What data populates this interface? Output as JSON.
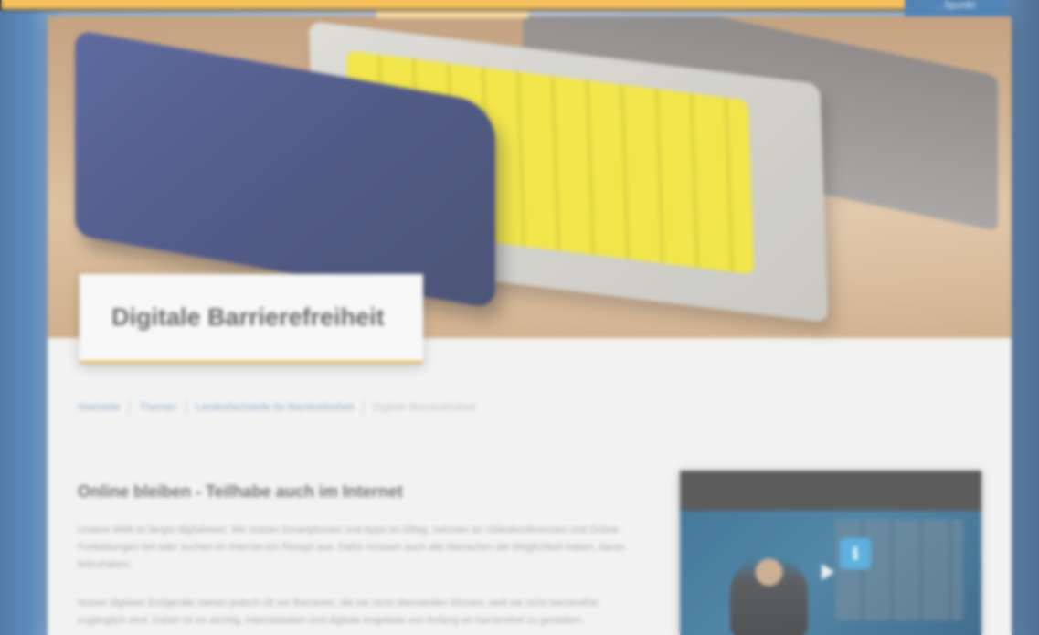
{
  "top": {
    "right_tab_label": "…bpunkt"
  },
  "hero": {
    "title": "Digitale Barrierefreiheit"
  },
  "breadcrumb": {
    "items": [
      "Startseite",
      "Themen",
      "Landesfachstelle für Barrierefreiheit"
    ],
    "current": "Digitale Barrierefreiheit"
  },
  "content": {
    "title": "Online bleiben - Teilhabe auch im Internet",
    "paragraph_1": "Unsere Welt ist längst digitalisiert. Wir nutzen Smartphones und Apps im Alltag, nehmen an Videokonferenzen und Online-Fortbildungen teil oder suchen im Internet ein Rezept aus. Dafür müssen auch alle Menschen die Möglichkeit haben, daran teilzuhaben.",
    "paragraph_2": "Nutzer digitaler Endgeräte stehen jedoch oft vor Barrieren, die sie nicht überwinden können, weil sie nicht barrierefrei zugänglich sind. Daher ist es wichtig, Internetseiten und digitale Angebote von Anfang an barrierefrei zu gestalten."
  },
  "video": {
    "info_icon_symbol": "ℹ"
  },
  "colors": {
    "accent": "#f6b53a",
    "link": "#7a9dc2",
    "heading": "#4b4b4b"
  }
}
